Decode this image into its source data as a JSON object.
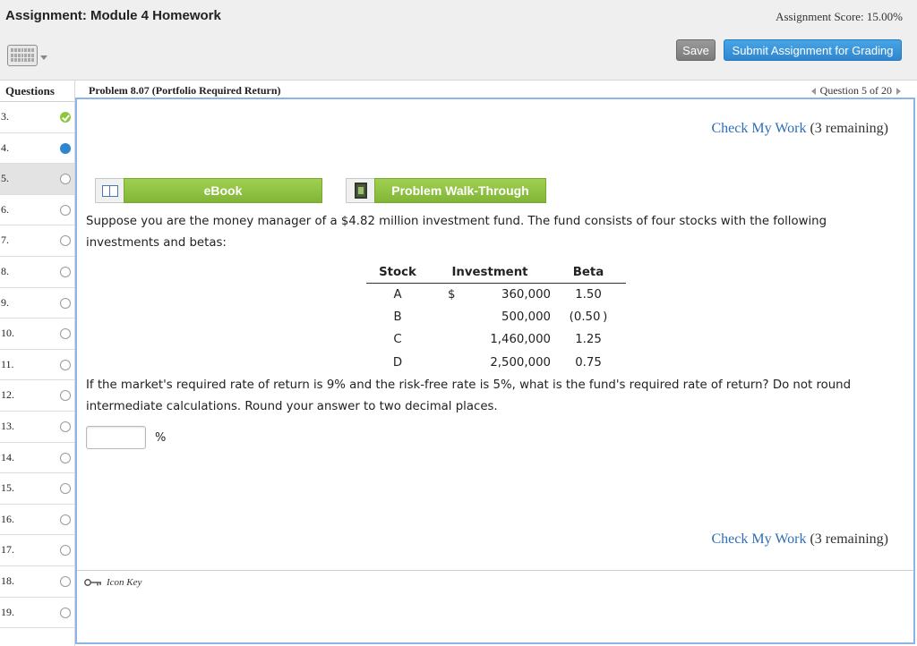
{
  "header": {
    "title": "Assignment: Module 4 Homework",
    "score": "Assignment Score: 15.00%",
    "save_label": "Save",
    "submit_label": "Submit Assignment for Grading"
  },
  "sidebar": {
    "heading": "Questions",
    "items": [
      {
        "label": "3.",
        "status": "done"
      },
      {
        "label": "4.",
        "status": "current"
      },
      {
        "label": "5.",
        "status": "open",
        "selected": true
      },
      {
        "label": "6.",
        "status": "open"
      },
      {
        "label": "7.",
        "status": "open"
      },
      {
        "label": "8.",
        "status": "open"
      },
      {
        "label": "9.",
        "status": "open"
      },
      {
        "label": "10.",
        "status": "open"
      },
      {
        "label": "11.",
        "status": "open"
      },
      {
        "label": "12.",
        "status": "open"
      },
      {
        "label": "13.",
        "status": "open"
      },
      {
        "label": "14.",
        "status": "open"
      },
      {
        "label": "15.",
        "status": "open"
      },
      {
        "label": "16.",
        "status": "open"
      },
      {
        "label": "17.",
        "status": "open"
      },
      {
        "label": "18.",
        "status": "open"
      },
      {
        "label": "19.",
        "status": "open"
      }
    ]
  },
  "problem": {
    "title": "Problem 8.07 (Portfolio Required Return)",
    "nav_label": "Question 5 of 20",
    "check_link": "Check My Work",
    "check_remaining": "(3 remaining)",
    "ebook_label": "eBook",
    "walkthrough_label": "Problem Walk-Through",
    "intro_text": "Suppose you are the money manager of a $4.82 million investment fund. The fund consists of four stocks with the following investments and betas:",
    "table": {
      "headers": [
        "Stock",
        "Investment",
        "Beta"
      ],
      "rows": [
        {
          "stock": "A",
          "dollar": "$",
          "investment": "360,000",
          "beta": "1.50"
        },
        {
          "stock": "B",
          "dollar": "",
          "investment": "500,000",
          "beta": "(0.50 )"
        },
        {
          "stock": "C",
          "dollar": "",
          "investment": "1,460,000",
          "beta": "1.25"
        },
        {
          "stock": "D",
          "dollar": "",
          "investment": "2,500,000",
          "beta": "0.75"
        }
      ]
    },
    "question_text": "If the market's required rate of return is 9% and the risk-free rate is 5%, what is the fund's required rate of return? Do not round intermediate calculations. Round your answer to two decimal places.",
    "answer_value": "",
    "answer_unit": "%",
    "icon_key_label": "Icon Key"
  },
  "colors": {
    "accent_blue": "#2f86cf",
    "link_blue": "#2e6db5",
    "resource_green": "#8dc63f",
    "panel_border": "#8eb4e3"
  }
}
